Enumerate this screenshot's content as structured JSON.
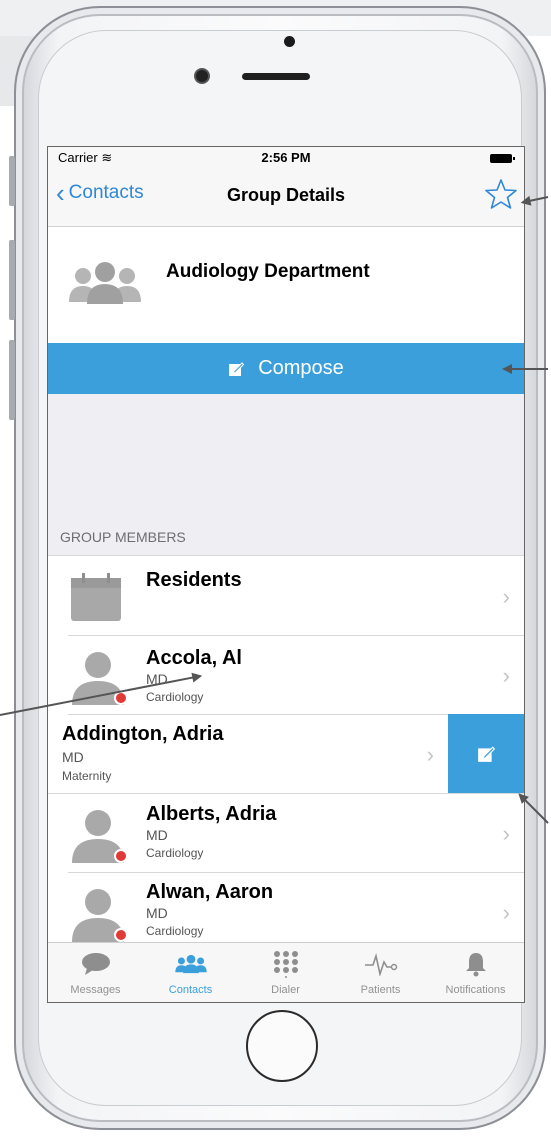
{
  "status": {
    "carrier": "Carrier",
    "time": "2:56 PM"
  },
  "nav": {
    "back_label": "Contacts",
    "title": "Group Details"
  },
  "group": {
    "name": "Audiology Department",
    "compose_label": "Compose"
  },
  "section_header": "GROUP MEMBERS",
  "members": [
    {
      "name": "Residents",
      "credential": "",
      "department": ""
    },
    {
      "name": "Accola, Al",
      "credential": "MD",
      "department": "Cardiology"
    },
    {
      "name": "Addington, Adria",
      "credential": "MD",
      "department": "Maternity"
    },
    {
      "name": "Alberts, Adria",
      "credential": "MD",
      "department": "Cardiology"
    },
    {
      "name": "Alwan, Aaron",
      "credential": "MD",
      "department": "Cardiology"
    }
  ],
  "tabs": [
    {
      "label": "Messages",
      "icon": "chat-bubble-icon",
      "active": false
    },
    {
      "label": "Contacts",
      "icon": "people-icon",
      "active": true
    },
    {
      "label": "Dialer",
      "icon": "keypad-icon",
      "active": false
    },
    {
      "label": "Patients",
      "icon": "pulse-icon",
      "active": false
    },
    {
      "label": "Notifications",
      "icon": "bell-icon",
      "active": false
    }
  ],
  "colors": {
    "accent": "#3a9fdb",
    "presence_busy": "#e03a37",
    "link": "#2f87d6"
  }
}
